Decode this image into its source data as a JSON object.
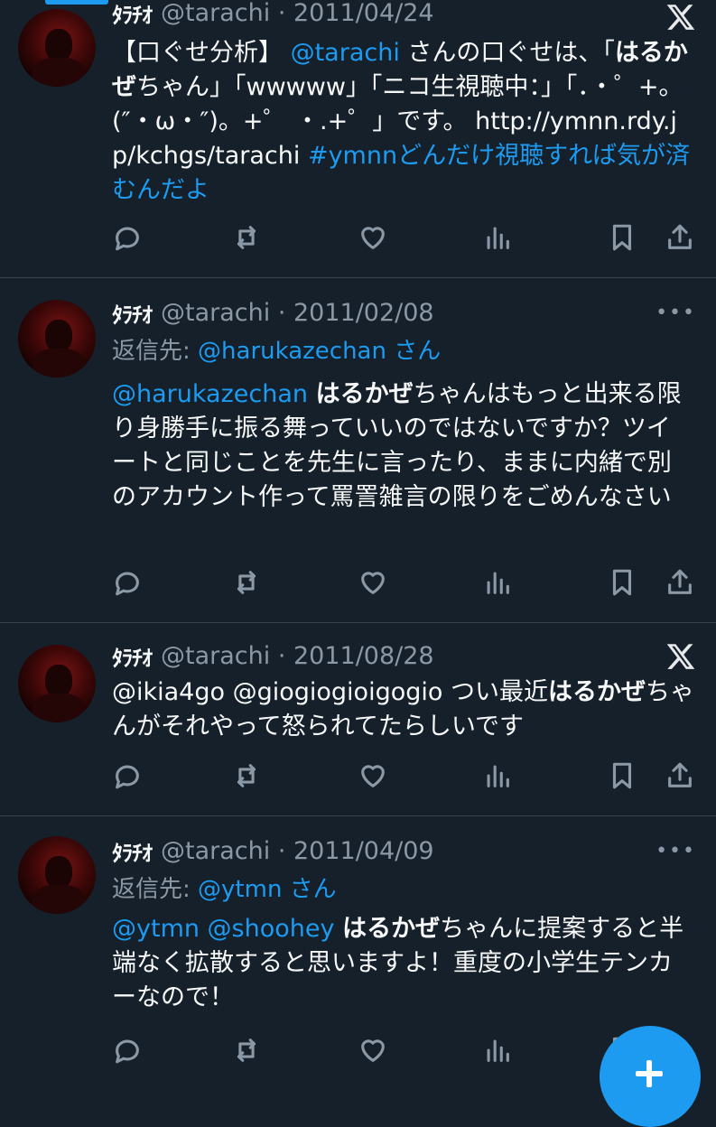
{
  "tweets": [
    {
      "author_name": "ﾀﾗﾁｵ",
      "handle_date": "@tarachi · 2011/04/24",
      "corner": "x-logo",
      "reply_prefix": "",
      "reply_handle": "",
      "reply_suffix": "",
      "text": [
        {
          "t": "【口ぐせ分析】 ",
          "s": "plain"
        },
        {
          "t": "@tarachi",
          "s": "link"
        },
        {
          "t": " さんの口ぐせは、「",
          "s": "plain"
        },
        {
          "t": "はるかぜ",
          "s": "bold"
        },
        {
          "t": "ちゃん」「wwwww」「ニコ生視聴中：」「．・゜+。(″・ω・″)。+゜ ・.+゜」です。 http://ymnn.rdy.jp/kchgs/tarachi ",
          "s": "plain"
        },
        {
          "t": "#ymnnどんだけ視聴すれば気が済むんだよ",
          "s": "link"
        }
      ]
    },
    {
      "author_name": "ﾀﾗﾁｵ",
      "handle_date": "@tarachi · 2011/02/08",
      "corner": "more",
      "reply_prefix": "返信先: ",
      "reply_handle": "@harukazechan",
      "reply_suffix": " さん",
      "text": [
        {
          "t": "@harukazechan",
          "s": "link"
        },
        {
          "t": " ",
          "s": "plain"
        },
        {
          "t": "はるかぜ",
          "s": "bold"
        },
        {
          "t": "ちゃんはもっと出来る限り身勝手に振る舞っていいのではないですか？ツイートと同じことを先生に言ったり、ままに内緒で別のアカウント作って罵詈雑言の限りをごめんなさい",
          "s": "plain"
        }
      ]
    },
    {
      "author_name": "ﾀﾗﾁｵ",
      "handle_date": "@tarachi · 2011/08/28",
      "corner": "x-logo",
      "reply_prefix": "",
      "reply_handle": "",
      "reply_suffix": "",
      "text": [
        {
          "t": "@ikia4go @giogiogioigogio つい最近",
          "s": "plain"
        },
        {
          "t": "はるかぜ",
          "s": "bold"
        },
        {
          "t": "ちゃんがそれやって怒られてたらしいです",
          "s": "plain"
        }
      ]
    },
    {
      "author_name": "ﾀﾗﾁｵ",
      "handle_date": "@tarachi · 2011/04/09",
      "corner": "more",
      "reply_prefix": "返信先: ",
      "reply_handle": "@ytmn",
      "reply_suffix": " さん",
      "text": [
        {
          "t": "@ytmn @shoohey",
          "s": "link"
        },
        {
          "t": " ",
          "s": "plain"
        },
        {
          "t": "はるかぜ",
          "s": "bold"
        },
        {
          "t": "ちゃんに提案すると半端なく拡散すると思いますよ！重度の小学生テンカーなので！",
          "s": "plain"
        }
      ]
    }
  ],
  "more_glyph": "•••",
  "action_icons": [
    "reply-icon",
    "retweet-icon",
    "like-icon",
    "views-icon",
    "bookmark-icon",
    "share-icon"
  ],
  "colors": {
    "background": "#15202b",
    "accent": "#1d9bf0",
    "muted": "#8b98a5",
    "divider": "#38444d"
  }
}
